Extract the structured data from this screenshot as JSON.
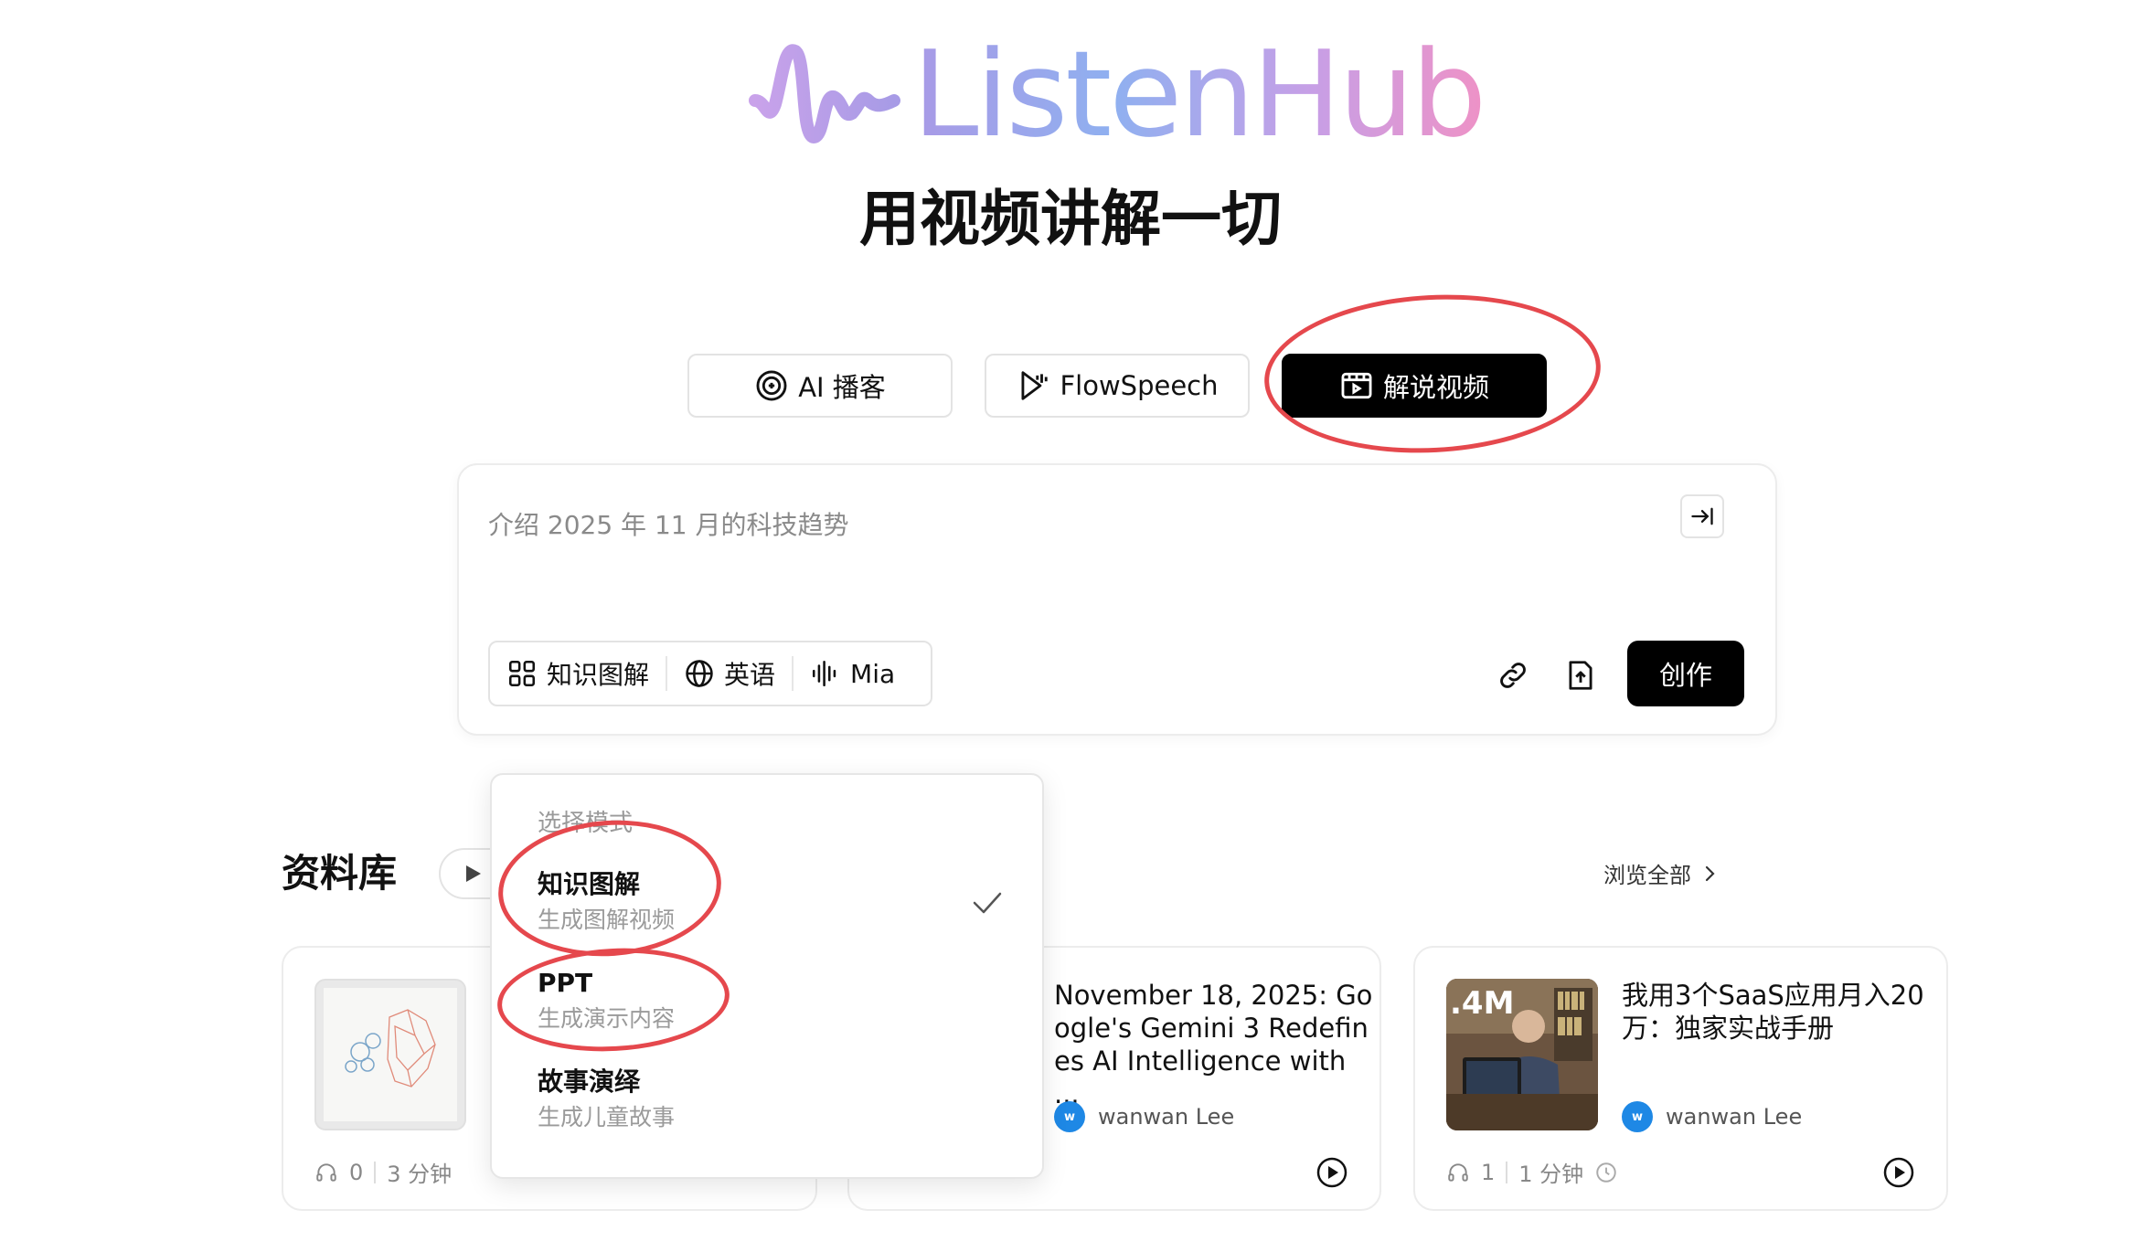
{
  "brand": {
    "logo_text": "ListenHub",
    "tagline": "用视频讲解一切"
  },
  "tabs": [
    {
      "label": "AI 播客",
      "icon": "podcast-icon",
      "active": false
    },
    {
      "label": "FlowSpeech",
      "icon": "flowspeech-icon",
      "active": false
    },
    {
      "label": "解说视频",
      "icon": "video-explain-icon",
      "active": true
    }
  ],
  "composer": {
    "placeholder": "介绍 2025 年 11 月的科技趋势",
    "options": [
      {
        "label": "知识图解",
        "icon": "grid-icon"
      },
      {
        "label": "英语",
        "icon": "globe-icon"
      },
      {
        "label": "Mia",
        "icon": "voice-waveform-icon"
      }
    ],
    "create_label": "创作"
  },
  "library": {
    "title": "资料库",
    "browse_all": "浏览全部",
    "cards": [
      {
        "title": "",
        "author": "",
        "listens": "0",
        "duration": "3 分钟"
      },
      {
        "title": "November 18, 2025: Google's Gemini 3 Redefines AI Intelligence with ...",
        "author": "wanwan Lee",
        "avatar_letter": "w"
      },
      {
        "title": "我用3个SaaS应用月入20万：独家实战手册",
        "author": "wanwan Lee",
        "avatar_letter": "w",
        "listens": "1",
        "duration": "1 分钟",
        "thumb_text": "4M"
      }
    ]
  },
  "dropdown": {
    "header": "选择模式",
    "items": [
      {
        "label": "知识图解",
        "desc": "生成图解视频",
        "selected": true
      },
      {
        "label": "PPT",
        "desc": "生成演示内容",
        "selected": false
      },
      {
        "label": "故事演绎",
        "desc": "生成儿童故事",
        "selected": false
      }
    ]
  },
  "colors": {
    "accent": "#000000",
    "annotation": "#e5484d",
    "avatar": "#1e88e5"
  }
}
